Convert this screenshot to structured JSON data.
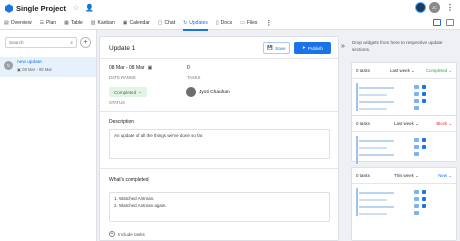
{
  "header": {
    "project_title": "Single Project",
    "avatar_initials": "JC"
  },
  "tabs": [
    {
      "label": "Overview",
      "icon": "overview-icon"
    },
    {
      "label": "Plan",
      "icon": "plan-icon"
    },
    {
      "label": "Table",
      "icon": "table-icon"
    },
    {
      "label": "Kanban",
      "icon": "kanban-icon"
    },
    {
      "label": "Calendar",
      "icon": "calendar-icon"
    },
    {
      "label": "Chat",
      "icon": "chat-icon"
    },
    {
      "label": "Updates",
      "icon": "updates-icon",
      "active": true
    },
    {
      "label": "Docs",
      "icon": "docs-icon"
    },
    {
      "label": "Files",
      "icon": "files-icon"
    }
  ],
  "sidebar": {
    "search_placeholder": "Search",
    "items": [
      {
        "name": "new update",
        "date": "08 Mar - 08 Mar"
      }
    ]
  },
  "update": {
    "title": "Update 1",
    "save_label": "Save",
    "publish_label": "Publish",
    "date_range": "08 Mar - 08 Mar",
    "date_range_label": "DATE RANGE",
    "tasks_count": "0",
    "tasks_label": "TASKS",
    "status_value": "Completed",
    "status_label": "STATUS",
    "assignee": "Jyoti Chauhan",
    "description_title": "Description",
    "description_text": "An update of all the things we've done so far.",
    "completed_title": "What's completed",
    "completed_items": [
      "1. Watched Antman.",
      "2. Watched Antman again."
    ],
    "include_tasks": "Include tasks"
  },
  "widgets": {
    "hint": "Drop widgets from here to respective update sections.",
    "cards": [
      {
        "tasks": "0 tasks",
        "period": "Last week",
        "status": "Completed",
        "status_color": "#2e9e4b"
      },
      {
        "tasks": "0 tasks",
        "period": "Last week",
        "status": "Block",
        "status_color": "#d93025"
      },
      {
        "tasks": "0 tasks",
        "period": "This week",
        "status": "New",
        "status_color": "#1a73e8"
      }
    ]
  },
  "colors": {
    "accent": "#1a73e8"
  }
}
